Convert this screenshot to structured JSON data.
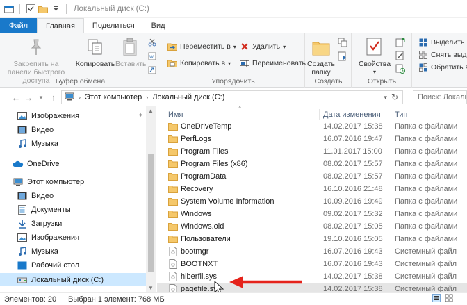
{
  "window": {
    "title": "Локальный диск (C:)"
  },
  "tabs": [
    {
      "label": "Файл"
    },
    {
      "label": "Главная"
    },
    {
      "label": "Поделиться"
    },
    {
      "label": "Вид"
    }
  ],
  "ribbon": {
    "clipboard": {
      "pin_label": "Закрепить на панели быстрого доступа",
      "copy_label": "Копировать",
      "paste_label": "Вставить",
      "group_label": "Буфер обмена"
    },
    "organize": {
      "move_label": "Переместить в",
      "copy_to_label": "Копировать в",
      "delete_label": "Удалить",
      "rename_label": "Переименовать",
      "group_label": "Упорядочить"
    },
    "create": {
      "new_folder_label": "Создать папку",
      "group_label": "Создать"
    },
    "open": {
      "properties_label": "Свойства",
      "group_label": "Открыть"
    },
    "select": {
      "select_all_label": "Выделить вс",
      "deselect_label": "Снять выде",
      "invert_label": "Обратить вы"
    }
  },
  "address": {
    "crumb1": "Этот компьютер",
    "crumb2": "Локальный диск (C:)",
    "search_placeholder": "Поиск: Локаль"
  },
  "nav": {
    "items": [
      {
        "label": "Изображения"
      },
      {
        "label": "Видео"
      },
      {
        "label": "Музыка"
      },
      {
        "label": "OneDrive"
      },
      {
        "label": "Этот компьютер"
      },
      {
        "label": "Видео"
      },
      {
        "label": "Документы"
      },
      {
        "label": "Загрузки"
      },
      {
        "label": "Изображения"
      },
      {
        "label": "Музыка"
      },
      {
        "label": "Рабочий стол"
      },
      {
        "label": "Локальный диск (C:)"
      }
    ]
  },
  "columns": {
    "name": "Имя",
    "date": "Дата изменения",
    "type": "Тип"
  },
  "files": [
    {
      "name": "OneDriveTemp",
      "date": "14.02.2017 15:38",
      "type": "Папка с файлами",
      "kind": "folder"
    },
    {
      "name": "PerfLogs",
      "date": "16.07.2016 19:47",
      "type": "Папка с файлами",
      "kind": "folder"
    },
    {
      "name": "Program Files",
      "date": "11.01.2017 15:00",
      "type": "Папка с файлами",
      "kind": "folder"
    },
    {
      "name": "Program Files (x86)",
      "date": "08.02.2017 15:57",
      "type": "Папка с файлами",
      "kind": "folder"
    },
    {
      "name": "ProgramData",
      "date": "08.02.2017 15:57",
      "type": "Папка с файлами",
      "kind": "folder"
    },
    {
      "name": "Recovery",
      "date": "16.10.2016 21:48",
      "type": "Папка с файлами",
      "kind": "folder"
    },
    {
      "name": "System Volume Information",
      "date": "10.09.2016 19:49",
      "type": "Папка с файлами",
      "kind": "folder"
    },
    {
      "name": "Windows",
      "date": "09.02.2017 15:32",
      "type": "Папка с файлами",
      "kind": "folder"
    },
    {
      "name": "Windows.old",
      "date": "08.02.2017 15:05",
      "type": "Папка с файлами",
      "kind": "folder"
    },
    {
      "name": "Пользователи",
      "date": "19.10.2016 15:05",
      "type": "Папка с файлами",
      "kind": "folder"
    },
    {
      "name": "bootmgr",
      "date": "16.07.2016 19:43",
      "type": "Системный файл",
      "kind": "sys"
    },
    {
      "name": "BOOTNXT",
      "date": "16.07.2016 19:43",
      "type": "Системный файл",
      "kind": "sys"
    },
    {
      "name": "hiberfil.sys",
      "date": "14.02.2017 15:38",
      "type": "Системный файл",
      "kind": "sys"
    },
    {
      "name": "pagefile.sys",
      "date": "14.02.2017 15:38",
      "type": "Системный файл",
      "kind": "sys"
    }
  ],
  "status": {
    "items_count": "Элементов: 20",
    "selection": "Выбран 1 элемент: 768 МБ"
  },
  "colors": {
    "file_tab": "#1979ca",
    "selection": "#cce8ff",
    "folder": "#f5c86b",
    "annotation_arrow": "#e5231b"
  }
}
